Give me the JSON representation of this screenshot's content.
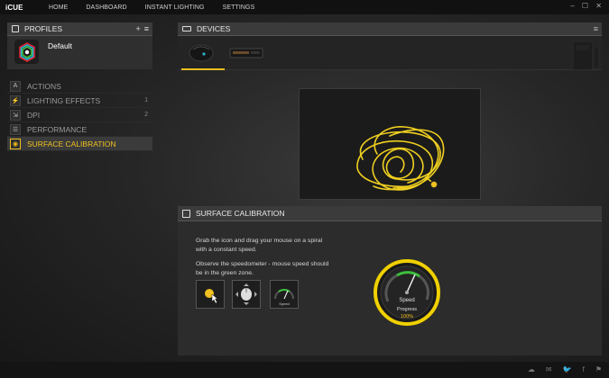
{
  "app": {
    "title": "iCUE"
  },
  "nav": {
    "items": [
      "HOME",
      "DASHBOARD",
      "INSTANT LIGHTING",
      "SETTINGS"
    ]
  },
  "window_controls": {
    "minimize": "–",
    "maximize": "☐",
    "close": "✕"
  },
  "profiles": {
    "title": "PROFILES",
    "add_label": "+",
    "list_label": "≡",
    "current": "Default"
  },
  "menu": {
    "items": [
      {
        "label": "ACTIONS",
        "icon": "A",
        "count": ""
      },
      {
        "label": "LIGHTING EFFECTS",
        "icon": "⚡",
        "count": "1"
      },
      {
        "label": "DPI",
        "icon": "⇲",
        "count": "2"
      },
      {
        "label": "PERFORMANCE",
        "icon": "☰",
        "count": ""
      },
      {
        "label": "SURFACE CALIBRATION",
        "icon": "◉",
        "count": ""
      }
    ]
  },
  "devices": {
    "title": "DEVICES",
    "menu_icon": "≡"
  },
  "surface_calibration": {
    "title": "SURFACE CALIBRATION",
    "instruction1": "Grab the icon and drag your mouse on a spiral with a constant speed.",
    "instruction2": "Observe the speedometer - mouse speed should be in the green zone.",
    "gauge_label": "Speed",
    "progress_label": "Progress",
    "progress_value": "100%",
    "mini_gauge_label": "Speed"
  },
  "colors": {
    "accent": "#f0c020",
    "green": "#3cbf3c"
  },
  "footer": {
    "icons": [
      "cloud-icon",
      "chat-icon",
      "twitter-icon",
      "facebook-icon",
      "corsair-icon"
    ]
  }
}
